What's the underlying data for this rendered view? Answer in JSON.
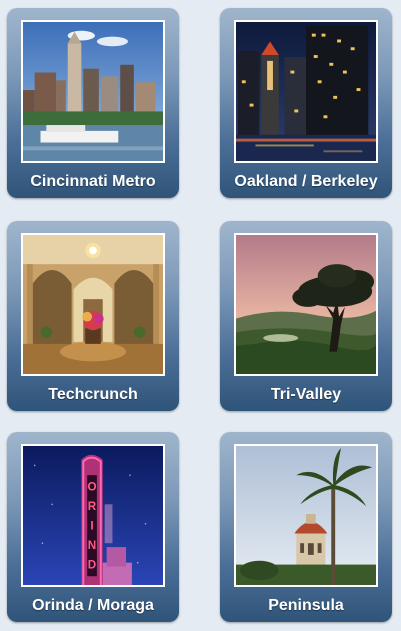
{
  "tiles": [
    {
      "label": "Cincinnati Metro",
      "image": "cincinnati-skyline-photo"
    },
    {
      "label": "Oakland / Berkeley",
      "image": "oakland-night-skyline-photo"
    },
    {
      "label": "Techcrunch",
      "image": "grand-lobby-interior-photo"
    },
    {
      "label": "Tri-Valley",
      "image": "oak-tree-golf-course-photo"
    },
    {
      "label": "Orinda / Moraga",
      "image": "orinda-theater-sign-photo"
    },
    {
      "label": "Peninsula",
      "image": "hoover-tower-palm-photo"
    }
  ]
}
